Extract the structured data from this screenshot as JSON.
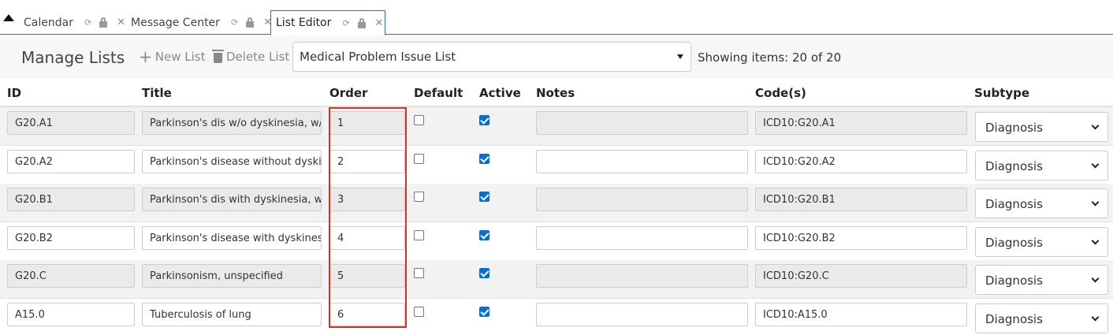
{
  "tabs": [
    {
      "label": "Calendar",
      "active": false
    },
    {
      "label": "Message Center",
      "active": false
    },
    {
      "label": "List Editor",
      "active": true
    }
  ],
  "toolbar": {
    "title": "Manage Lists",
    "new_list_label": "New List",
    "delete_list_label": "Delete List",
    "selected_list": "Medical Problem Issue List",
    "showing_text": "Showing items: 20 of 20"
  },
  "table": {
    "headers": {
      "id": "ID",
      "title": "Title",
      "order": "Order",
      "default": "Default",
      "active": "Active",
      "notes": "Notes",
      "codes": "Code(s)",
      "subtype": "Subtype"
    },
    "rows": [
      {
        "id": "G20.A1",
        "title": "Parkinson's dis w/o dyskinesia, w/o mention of fluctuations",
        "order": "1",
        "default": false,
        "active": true,
        "notes": "",
        "codes": "ICD10:G20.A1",
        "subtype": "Diagnosis"
      },
      {
        "id": "G20.A2",
        "title": "Parkinson's disease without dyskinesia, with fluctuations",
        "order": "2",
        "default": false,
        "active": true,
        "notes": "",
        "codes": "ICD10:G20.A2",
        "subtype": "Diagnosis"
      },
      {
        "id": "G20.B1",
        "title": "Parkinson's dis with dyskinesia, w/o mention of fluctuations",
        "order": "3",
        "default": false,
        "active": true,
        "notes": "",
        "codes": "ICD10:G20.B1",
        "subtype": "Diagnosis"
      },
      {
        "id": "G20.B2",
        "title": "Parkinson's disease with dyskinesia, with fluctuations",
        "order": "4",
        "default": false,
        "active": true,
        "notes": "",
        "codes": "ICD10:G20.B2",
        "subtype": "Diagnosis"
      },
      {
        "id": "G20.C",
        "title": "Parkinsonism, unspecified",
        "order": "5",
        "default": false,
        "active": true,
        "notes": "",
        "codes": "ICD10:G20.C",
        "subtype": "Diagnosis"
      },
      {
        "id": "A15.0",
        "title": "Tuberculosis of lung",
        "order": "6",
        "default": false,
        "active": true,
        "notes": "",
        "codes": "ICD10:A15.0",
        "subtype": "Diagnosis"
      }
    ]
  },
  "colors": {
    "accent": "#1f7a9c",
    "highlight": "#d93025",
    "checkbox": "#0a6ed1"
  }
}
